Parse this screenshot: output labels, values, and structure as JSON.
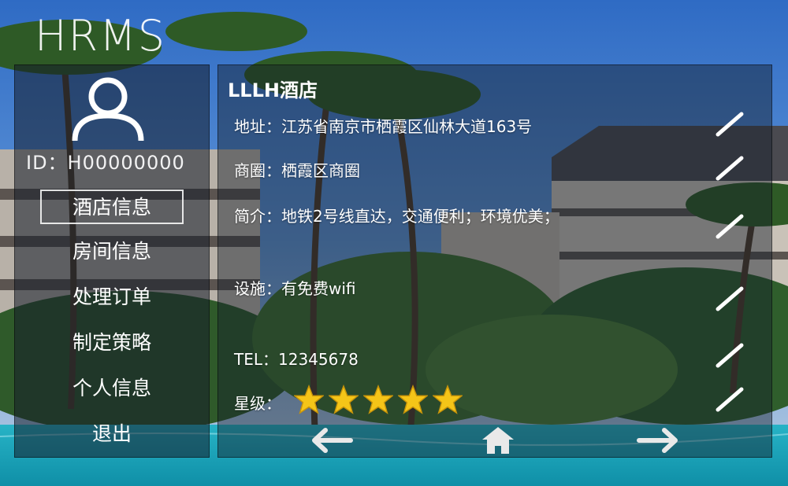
{
  "app": {
    "title": "HRMS"
  },
  "user": {
    "id_label": "ID：H00000000"
  },
  "nav": {
    "items": [
      {
        "label": "酒店信息",
        "active": true
      },
      {
        "label": "房间信息",
        "active": false
      },
      {
        "label": "处理订单",
        "active": false
      },
      {
        "label": "制定策略",
        "active": false
      },
      {
        "label": "个人信息",
        "active": false
      },
      {
        "label": "退出",
        "active": false
      }
    ]
  },
  "hotel": {
    "name": "LLLH酒店",
    "address": "地址：江苏省南京市栖霞区仙林大道163号",
    "business_area": "商圈：栖霞区商圈",
    "intro": "简介：地铁2号线直达，交通便利；环境优美；",
    "facilities": "设施：有免费wifi",
    "tel": "TEL：12345678",
    "star_label": "星级：",
    "star_rating": 5,
    "star_color": "#f5c518"
  },
  "icons": {
    "avatar": "user-icon",
    "edit": "pencil-icon",
    "back": "arrow-left-icon",
    "home": "home-icon",
    "forward": "arrow-right-icon"
  }
}
